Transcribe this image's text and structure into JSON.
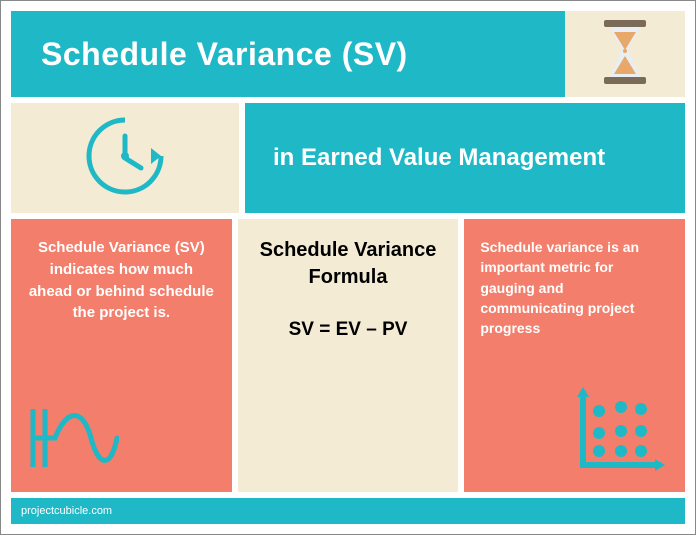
{
  "colors": {
    "teal": "#1FB8C6",
    "cream": "#F3EBD3",
    "coral": "#F27E6B",
    "sand": "#E8A86A"
  },
  "header": {
    "title": "Schedule Variance (SV)",
    "subtitle": "in Earned Value Management"
  },
  "columns": {
    "left": {
      "text": "Schedule Variance (SV) indicates how much ahead or behind schedule the project is."
    },
    "middle": {
      "title": "Schedule Variance Formula",
      "formula": "SV = EV – PV"
    },
    "right": {
      "text": "Schedule variance is an important metric for gauging and communicating project progress"
    }
  },
  "footer": {
    "source": "projectcubicle.com"
  },
  "icons": {
    "hourglass": "hourglass-icon",
    "clock": "clock-arrow-icon",
    "wave": "wave-icon",
    "scatter": "scatter-plot-icon"
  }
}
